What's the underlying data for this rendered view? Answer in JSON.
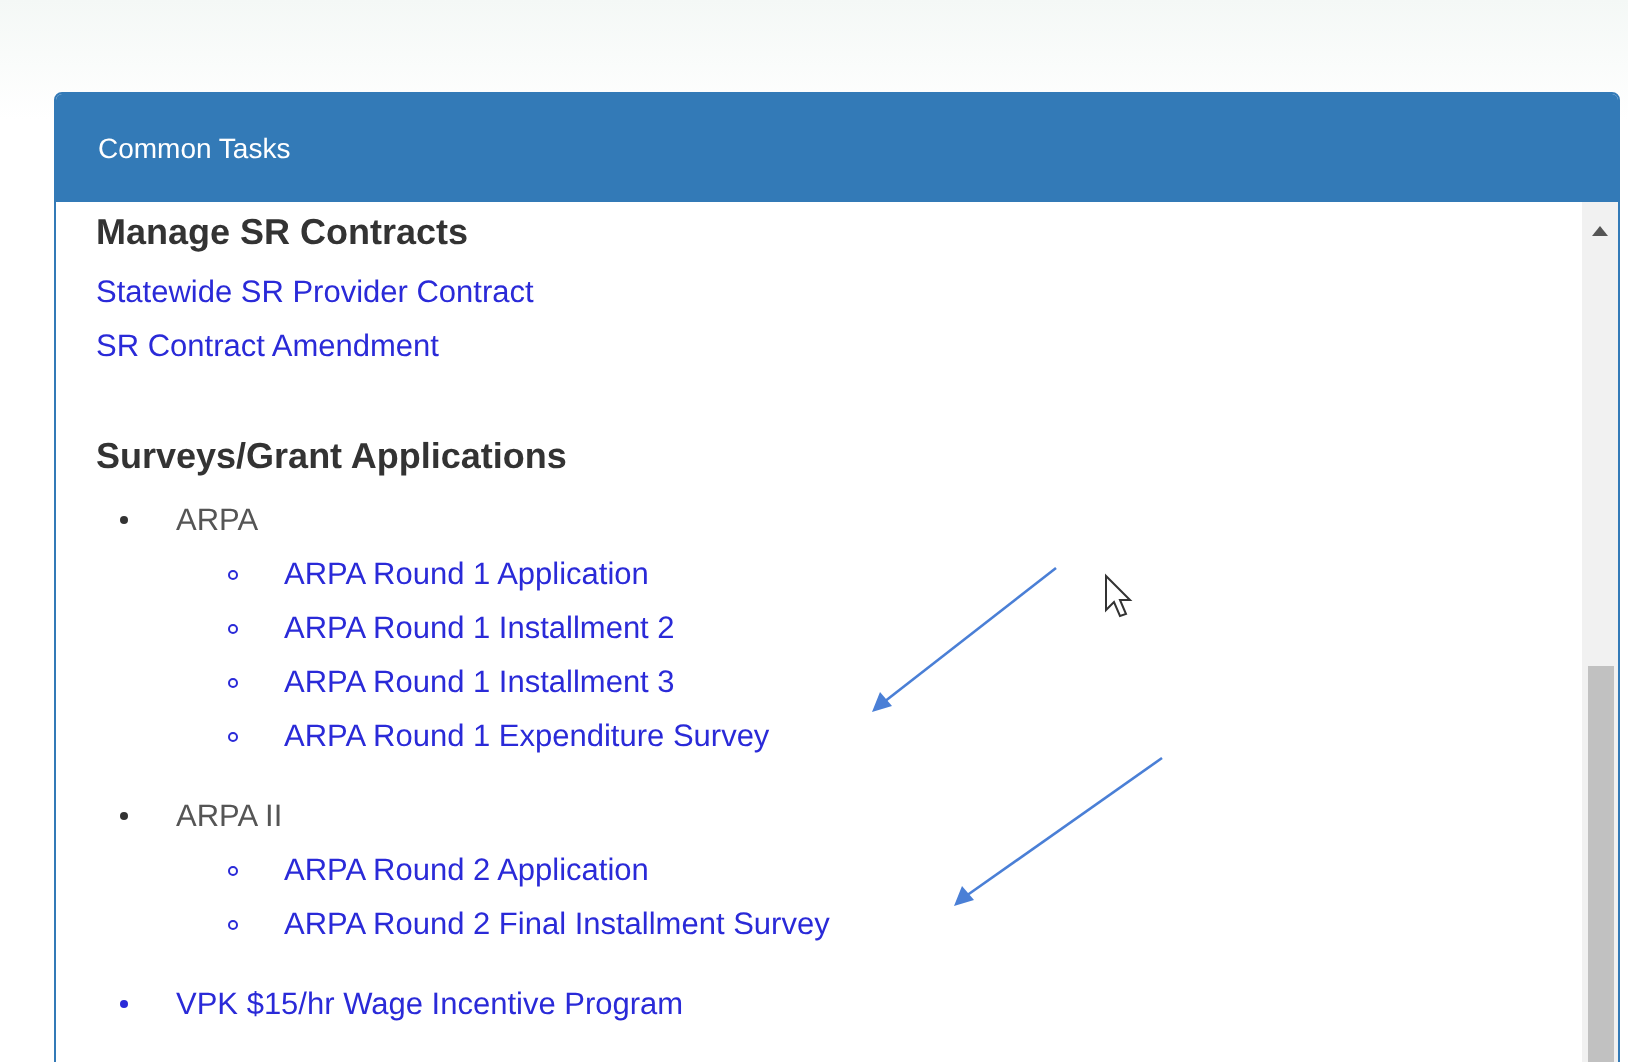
{
  "panel": {
    "title": "Common Tasks"
  },
  "sections": [
    {
      "heading": "Manage SR Contracts",
      "items": [
        {
          "kind": "link",
          "label": "Statewide SR Provider Contract"
        },
        {
          "kind": "link",
          "label": "SR Contract Amendment"
        }
      ]
    },
    {
      "heading": "Surveys/Grant Applications",
      "items": [
        {
          "kind": "group",
          "label": "ARPA",
          "children": [
            "ARPA Round 1 Application",
            "ARPA Round 1 Installment 2",
            "ARPA Round 1 Installment 3",
            "ARPA Round 1 Expenditure Survey"
          ]
        },
        {
          "kind": "group",
          "label": "ARPA II",
          "children": [
            "ARPA Round 2 Application",
            "ARPA Round 2 Final Installment Survey"
          ]
        },
        {
          "kind": "bullet-link",
          "label": "VPK $15/hr Wage Incentive Program"
        }
      ]
    }
  ]
}
